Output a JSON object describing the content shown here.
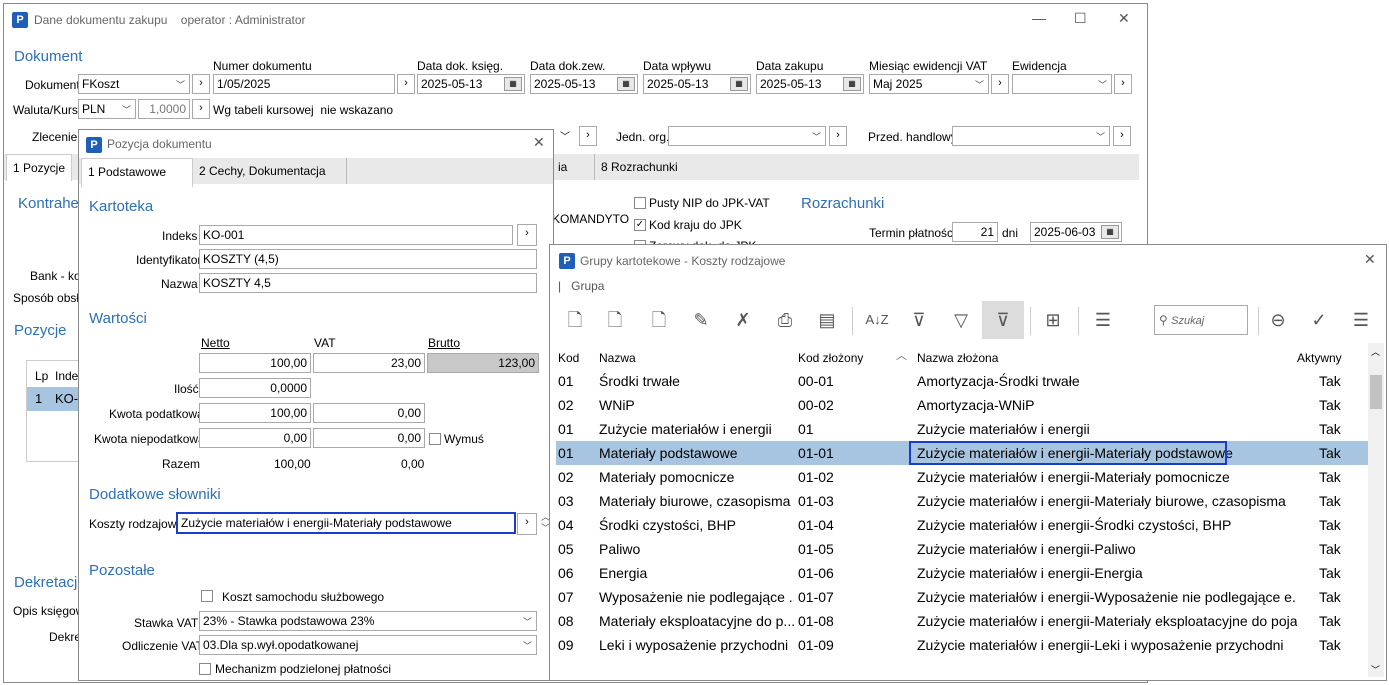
{
  "main": {
    "title": "Dane dokumentu zakupu",
    "operator": "operator : Administrator",
    "section_dokument": "Dokument",
    "dokument_label": "Dokument",
    "dokument_value": "FKoszt",
    "numer_label": "Numer dokumentu",
    "numer_value": "1/05/2025",
    "data_ksieg_label": "Data dok. księg.",
    "data_ksieg_value": "2025-05-13",
    "data_zew_label": "Data dok.zew.",
    "data_zew_value": "2025-05-13",
    "data_wplywu_label": "Data wpływu",
    "data_wplywu_value": "2025-05-13",
    "data_zakupu_label": "Data zakupu",
    "data_zakupu_value": "2025-05-13",
    "miesiac_label": "Miesiąc ewidencji VAT",
    "miesiac_value": "Maj 2025",
    "ewidencja_label": "Ewidencja",
    "waluta_label": "Waluta/Kurs",
    "waluta_value": "PLN",
    "kurs_value": "1,0000",
    "tabela_label": "Wg tabeli kursowej",
    "tabela_value": "nie wskazano",
    "zlecenie_label": "Zlecenie",
    "jedn_org_label": "Jedn. org.",
    "przed_label": "Przed. handlowy",
    "tab1": "1 Pozycje",
    "tab_ia": "ia",
    "tab8": "8 Rozrachunki",
    "kontrahent_label": "Kontrahe",
    "komandyt": "KOMANDYTO",
    "pusty_nip": "Pusty NIP do JPK-VAT",
    "kod_kraju": "Kod kraju do JPK",
    "zerowy": "Zerowy dok. do JPK",
    "rozrachunki": "Rozrachunki",
    "termin_label": "Termin płatności",
    "termin_days": "21",
    "dni": "dni",
    "termin_date": "2025-06-03",
    "bank_label": "Bank - kor",
    "sposob_label": "Sposób obsłu",
    "pozycje_label": "Pozycje",
    "lp_hdr": "Lp",
    "indeks_hdr": "Indeks",
    "row_lp": "1",
    "row_idx": "KO-0",
    "dekretacja": "Dekretacja",
    "opis_label": "Opis księgowy",
    "dekre_label": "Dekre"
  },
  "pozycja": {
    "title": "Pozycja dokumentu",
    "tab1": "1 Podstawowe",
    "tab2": "2 Cechy, Dokumentacja",
    "kartoteka": "Kartoteka",
    "indeks_label": "Indeks",
    "indeks_value": "KO-001",
    "ident_label": "Identyfikator",
    "ident_value": "KOSZTY (4,5)",
    "nazwa_label": "Nazwa",
    "nazwa_value": "KOSZTY 4,5",
    "wartosci": "Wartości",
    "netto_hdr": "Netto",
    "vat_hdr": "VAT",
    "brutto_hdr": "Brutto",
    "netto": "100,00",
    "vat": "23,00",
    "brutto": "123,00",
    "ilosc_label": "Ilość",
    "ilosc": "0,0000",
    "kwota_pod_label": "Kwota podatkowa",
    "kwota_pod_netto": "100,00",
    "kwota_pod_vat": "0,00",
    "kwota_niepod_label": "Kwota niepodatkowa",
    "kwota_niepod_netto": "0,00",
    "kwota_niepod_vat": "0,00",
    "wymus": "Wymuś",
    "razem_label": "Razem",
    "razem_netto": "100,00",
    "razem_vat": "0,00",
    "dodatkowe": "Dodatkowe słowniki",
    "koszty_label": "Koszty rodzajowe",
    "koszty_value": "Zużycie materiałów i energii-Materiały podstawowe",
    "pozostale": "Pozostałe",
    "koszt_samochodu": "Koszt samochodu służbowego",
    "stawka_label": "Stawka VAT",
    "stawka_value": "23% - Stawka podstawowa 23%",
    "odliczenie_label": "Odliczenie VAT",
    "odliczenie_value": "03.Dla sp.wył.opodatkowanej",
    "mechanizm": "Mechanizm podzielonej płatności"
  },
  "grupy": {
    "title": "Grupy kartotekowe - Koszty rodzajowe",
    "menu_grupa": "Grupa",
    "search_placeholder": "Szukaj",
    "col_kod": "Kod",
    "col_nazwa": "Nazwa",
    "col_kod_zlozony": "Kod złożony",
    "col_nazwa_zlozona": "Nazwa złożona",
    "col_aktywny": "Aktywny",
    "rows": [
      {
        "kod": "01",
        "nazwa": "Środki trwałe",
        "kodz": "00-01",
        "nazwaz": "Amortyzacja-Środki trwałe",
        "akt": "Tak"
      },
      {
        "kod": "02",
        "nazwa": "WNiP",
        "kodz": "00-02",
        "nazwaz": "Amortyzacja-WNiP",
        "akt": "Tak"
      },
      {
        "kod": "01",
        "nazwa": "Zużycie materiałów i energii",
        "kodz": "01",
        "nazwaz": "Zużycie materiałów i energii",
        "akt": "Tak"
      },
      {
        "kod": "01",
        "nazwa": "Materiały podstawowe",
        "kodz": "01-01",
        "nazwaz": "Zużycie materiałów i energii-Materiały podstawowe",
        "akt": "Tak"
      },
      {
        "kod": "02",
        "nazwa": "Materiały pomocnicze",
        "kodz": "01-02",
        "nazwaz": "Zużycie materiałów i energii-Materiały pomocnicze",
        "akt": "Tak"
      },
      {
        "kod": "03",
        "nazwa": "Materiały biurowe, czasopisma",
        "kodz": "01-03",
        "nazwaz": "Zużycie materiałów i energii-Materiały biurowe, czasopisma",
        "akt": "Tak"
      },
      {
        "kod": "04",
        "nazwa": "Środki czystości, BHP",
        "kodz": "01-04",
        "nazwaz": "Zużycie materiałów i energii-Środki czystości, BHP",
        "akt": "Tak"
      },
      {
        "kod": "05",
        "nazwa": "Paliwo",
        "kodz": "01-05",
        "nazwaz": "Zużycie materiałów i energii-Paliwo",
        "akt": "Tak"
      },
      {
        "kod": "06",
        "nazwa": "Energia",
        "kodz": "01-06",
        "nazwaz": "Zużycie materiałów i energii-Energia",
        "akt": "Tak"
      },
      {
        "kod": "07",
        "nazwa": "Wyposażenie nie podlegające ...",
        "kodz": "01-07",
        "nazwaz": "Zużycie materiałów i energii-Wyposażenie nie podlegające e...",
        "akt": "Tak"
      },
      {
        "kod": "08",
        "nazwa": "Materiały eksploatacyjne do p...",
        "kodz": "01-08",
        "nazwaz": "Zużycie materiałów i energii-Materiały eksploatacyjne do poja...",
        "akt": "Tak"
      },
      {
        "kod": "09",
        "nazwa": "Leki  i wyposażenie przychodni",
        "kodz": "01-09",
        "nazwaz": "Zużycie materiałów i energii-Leki  i wyposażenie przychodni",
        "akt": "Tak"
      }
    ]
  }
}
